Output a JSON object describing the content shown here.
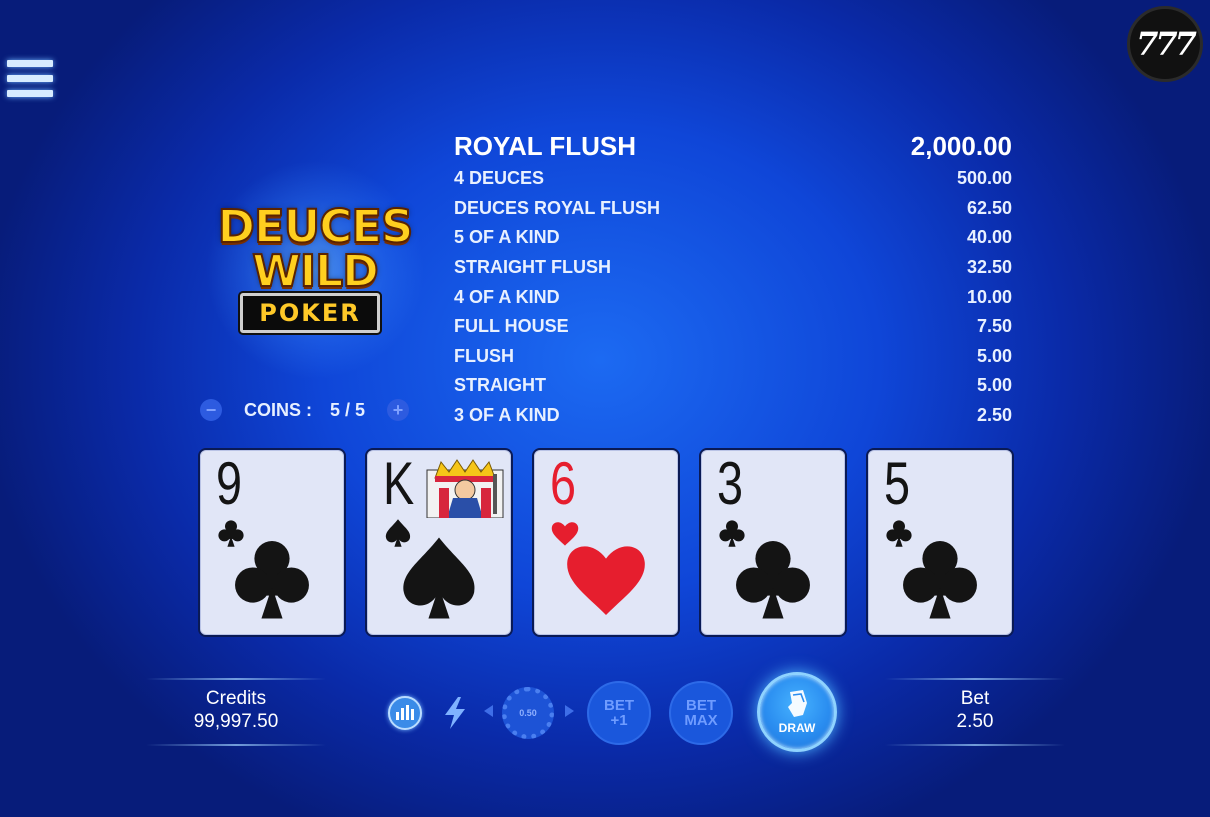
{
  "app": {
    "brand_logo": "777"
  },
  "game_logo": {
    "line1": "DEUCES",
    "line2": "WILD",
    "line3": "POKER"
  },
  "coins": {
    "label": "COINS :",
    "value": "5 / 5",
    "minus_icon": "minus-icon",
    "plus_icon": "plus-icon"
  },
  "paytable": [
    {
      "hand": "ROYAL FLUSH",
      "payout": "2,000.00"
    },
    {
      "hand": "4 DEUCES",
      "payout": "500.00"
    },
    {
      "hand": "DEUCES ROYAL FLUSH",
      "payout": "62.50"
    },
    {
      "hand": "5 OF A KIND",
      "payout": "40.00"
    },
    {
      "hand": "STRAIGHT FLUSH",
      "payout": "32.50"
    },
    {
      "hand": "4 OF A KIND",
      "payout": "10.00"
    },
    {
      "hand": "FULL HOUSE",
      "payout": "7.50"
    },
    {
      "hand": "FLUSH",
      "payout": "5.00"
    },
    {
      "hand": "STRAIGHT",
      "payout": "5.00"
    },
    {
      "hand": "3 OF A KIND",
      "payout": "2.50"
    }
  ],
  "cards": [
    {
      "rank": "9",
      "suit": "clubs",
      "color": "#141414"
    },
    {
      "rank": "K",
      "suit": "spades",
      "color": "#141414"
    },
    {
      "rank": "6",
      "suit": "hearts",
      "color": "#e61e2e"
    },
    {
      "rank": "3",
      "suit": "clubs",
      "color": "#141414"
    },
    {
      "rank": "5",
      "suit": "clubs",
      "color": "#141414"
    }
  ],
  "credits": {
    "label": "Credits",
    "value": "99,997.50"
  },
  "bet": {
    "label": "Bet",
    "value": "2.50"
  },
  "controls": {
    "chip_value": "0.50",
    "bet_one_line1": "BET",
    "bet_one_line2": "+1",
    "bet_max_line1": "BET",
    "bet_max_line2": "MAX",
    "draw_label": "DRAW"
  },
  "colors": {
    "accent": "#2a8df0",
    "background": "#0f46d8",
    "card_face": "#e1e6f7",
    "red_suit": "#e61e2e"
  }
}
